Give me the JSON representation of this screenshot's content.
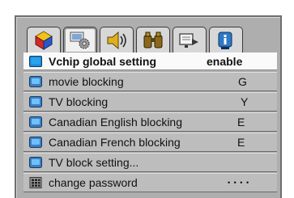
{
  "tabs": [
    {
      "icon": "shapes-icon",
      "active": false
    },
    {
      "icon": "settings-icon",
      "active": true
    },
    {
      "icon": "speaker-icon",
      "active": false
    },
    {
      "icon": "binoculars-icon",
      "active": false
    },
    {
      "icon": "input-source-icon",
      "active": false
    },
    {
      "icon": "info-icon",
      "active": false
    }
  ],
  "menu": [
    {
      "label": "Vchip global setting",
      "value": "enable",
      "icon": "screen-icon",
      "selected": true
    },
    {
      "label": "movie blocking",
      "value": "G",
      "icon": "tv-icon",
      "selected": false
    },
    {
      "label": "TV blocking",
      "value": "Y",
      "icon": "tv-icon",
      "selected": false
    },
    {
      "label": "Canadian English blocking",
      "value": "E",
      "icon": "tv-icon",
      "selected": false
    },
    {
      "label": "Canadian French blocking",
      "value": "E",
      "icon": "tv-icon",
      "selected": false
    },
    {
      "label": "TV block setting...",
      "value": "",
      "icon": "tv-icon",
      "selected": false
    },
    {
      "label": "change password",
      "value": "• • • •",
      "icon": "keypad-icon",
      "selected": false
    }
  ],
  "colors": {
    "panel": "#aeaeae",
    "row": "#bdbdbd",
    "selected_row": "#fafafa",
    "accent": "#1e8ad6"
  }
}
